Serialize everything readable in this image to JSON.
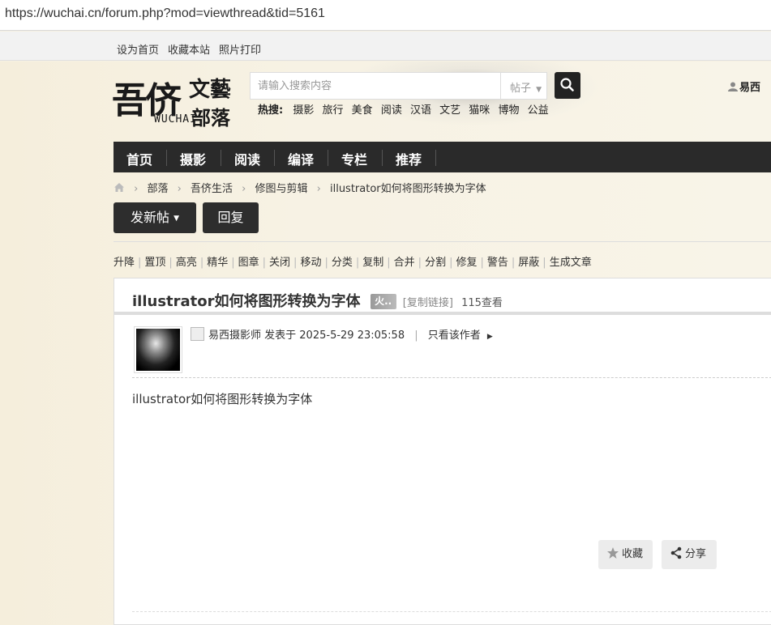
{
  "browser": {
    "url": "https://wuchai.cn/forum.php?mod=viewthread&tid=5161"
  },
  "topbar": {
    "links": [
      "设为首页",
      "收藏本站",
      "照片打印"
    ]
  },
  "logo": {
    "line1": "吾侪",
    "line2a": "文藝",
    "line2b": "部落",
    "en": "WUCHAI"
  },
  "search": {
    "placeholder": "请输入搜索内容",
    "type_label": "帖子"
  },
  "hot": {
    "label": "热搜:",
    "terms": [
      "摄影",
      "旅行",
      "美食",
      "阅读",
      "汉语",
      "文艺",
      "猫咪",
      "博物",
      "公益"
    ]
  },
  "user": {
    "name": "易西"
  },
  "nav": {
    "items": [
      "首页",
      "摄影",
      "阅读",
      "编译",
      "专栏",
      "推荐"
    ]
  },
  "breadcrumb": {
    "items": [
      "部落",
      "吾侪生活",
      "修图与剪辑",
      "illustrator如何将图形转换为字体"
    ]
  },
  "actions": {
    "new_post": "发新帖",
    "reply": "回复"
  },
  "mod_tools": [
    "升降",
    "置顶",
    "高亮",
    "精华",
    "图章",
    "关闭",
    "移动",
    "分类",
    "复制",
    "合并",
    "分割",
    "修复",
    "警告",
    "屏蔽",
    "生成文章"
  ],
  "thread": {
    "title": "illustrator如何将图形转换为字体",
    "hot_badge": "火..",
    "copy_link": "[复制链接]",
    "views": "115查看",
    "author": "易西摄影师",
    "posted": "发表于 2025-5-29 23:05:58",
    "only_author": "只看该作者",
    "content": "illustrator如何将图形转换为字体",
    "favorite": "收藏",
    "share": "分享"
  },
  "colors": {
    "nav_bg": "#2a2a2a",
    "page_bg": "#f6f1e2",
    "button_dark": "#2d2d2d"
  }
}
